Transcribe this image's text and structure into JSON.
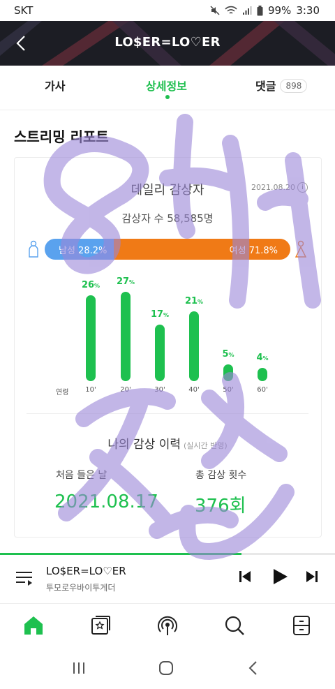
{
  "status_bar": {
    "carrier": "SKT",
    "battery": "99%",
    "time": "3:30"
  },
  "header": {
    "title": "LO$ER=LO♡ER"
  },
  "tabs": [
    {
      "label": "가사"
    },
    {
      "label": "상세정보"
    },
    {
      "label": "댓글",
      "badge": "898"
    }
  ],
  "report": {
    "section_title": "스트리밍 리포트",
    "daily_title": "데일리 감상자",
    "date": "2021.08.20",
    "info_symbol": "i",
    "listener_count": "감상자 수 58,585명",
    "male_label": "남성 28.2%",
    "female_label": "여성 71.8%",
    "male_share": 28.2,
    "female_share": 71.8,
    "age_axis_label": "연령",
    "ages": [
      {
        "age": "10'",
        "pct": 26,
        "label": "26"
      },
      {
        "age": "20'",
        "pct": 27,
        "label": "27"
      },
      {
        "age": "30'",
        "pct": 17,
        "label": "17"
      },
      {
        "age": "40'",
        "pct": 21,
        "label": "21"
      },
      {
        "age": "50'",
        "pct": 5,
        "label": "5"
      },
      {
        "age": "60'",
        "pct": 4,
        "label": "4"
      }
    ],
    "pct_unit": "%",
    "my_history_title": "나의 감상 이력",
    "my_history_note": "(실시간 반영)",
    "first_listen_label": "처음 들은 날",
    "first_listen_value": "2021.08.17",
    "total_count_label": "총 감상 횟수",
    "total_count_value": "376회"
  },
  "player": {
    "song_title": "LO$ER=LO♡ER",
    "artist": "투모로우바이투게더",
    "progress": 0.72
  },
  "colors": {
    "accent": "#1ec04f",
    "male": "#5aa2ee",
    "female": "#f07a16",
    "header_bg": "#1c1d24"
  },
  "icons": {
    "nav": [
      "home-icon",
      "my-library-icon",
      "podcast-icon",
      "search-icon",
      "menu-drawer-icon"
    ],
    "system": [
      "recent-apps-icon",
      "home-circle-icon",
      "back-chevron-icon"
    ]
  }
}
